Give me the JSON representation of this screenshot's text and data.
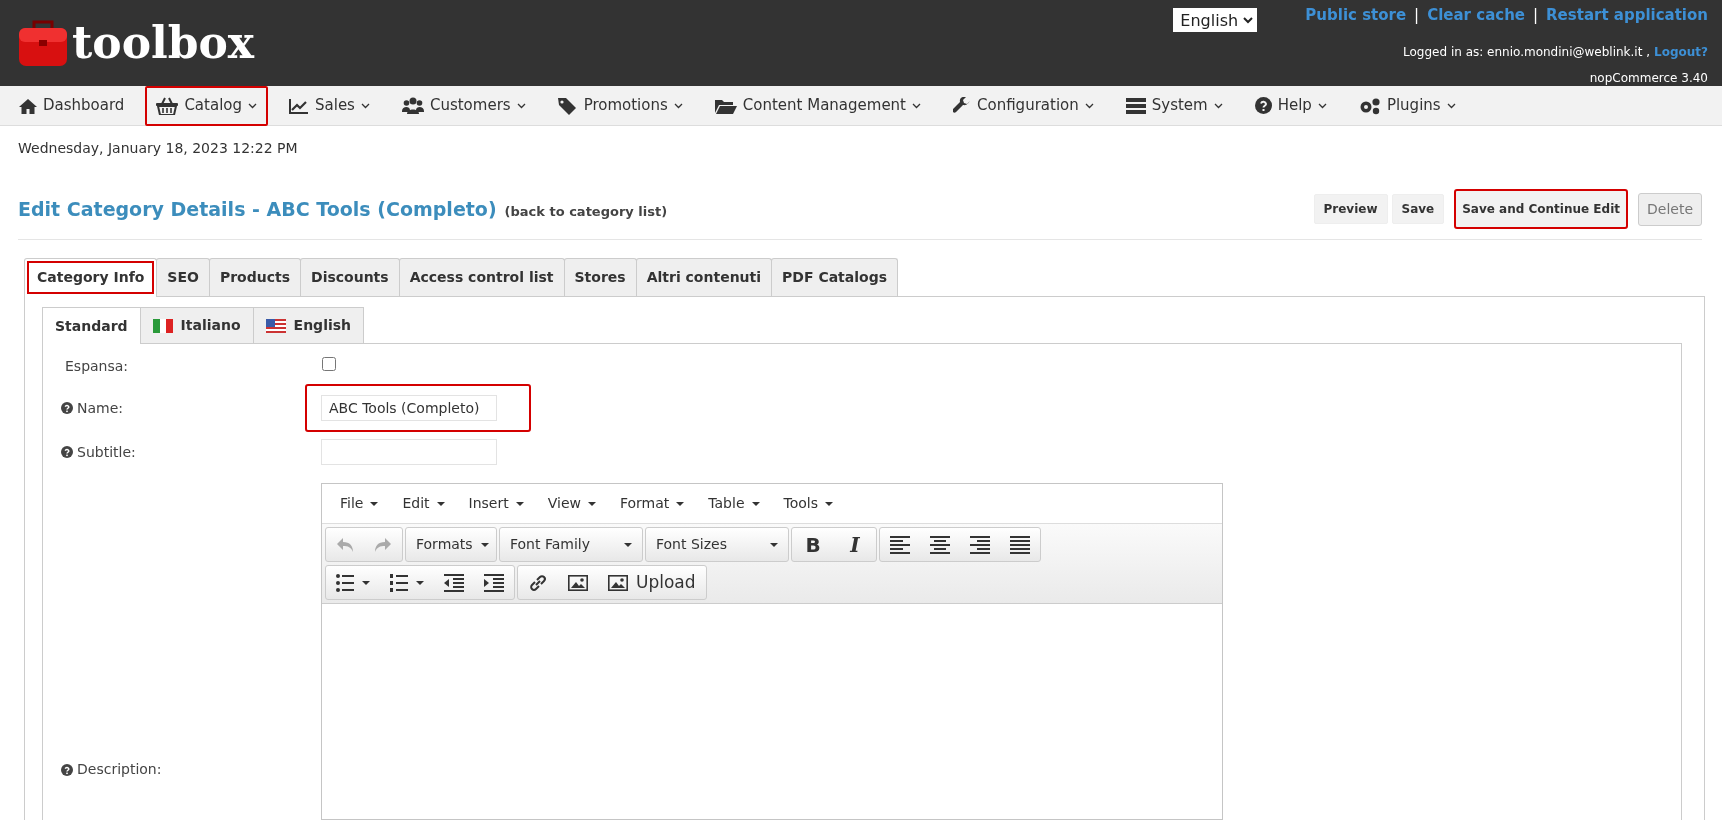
{
  "header": {
    "logo_text": "toolbox",
    "language": "English",
    "links": [
      "Public store",
      "Clear cache",
      "Restart application"
    ],
    "link_separator": "|",
    "logged_in": "Logged in as: ennio.mondini@weblink.it ,",
    "logout": "Logout?",
    "version": "nopCommerce 3.40"
  },
  "menu": [
    {
      "label": "Dashboard",
      "dropdown": false,
      "highlighted": false
    },
    {
      "label": "Catalog",
      "dropdown": true,
      "highlighted": true
    },
    {
      "label": "Sales",
      "dropdown": true,
      "highlighted": false
    },
    {
      "label": "Customers",
      "dropdown": true,
      "highlighted": false
    },
    {
      "label": "Promotions",
      "dropdown": true,
      "highlighted": false
    },
    {
      "label": "Content Management",
      "dropdown": true,
      "highlighted": false
    },
    {
      "label": "Configuration",
      "dropdown": true,
      "highlighted": false
    },
    {
      "label": "System",
      "dropdown": true,
      "highlighted": false
    },
    {
      "label": "Help",
      "dropdown": true,
      "highlighted": false
    },
    {
      "label": "Plugins",
      "dropdown": true,
      "highlighted": false
    }
  ],
  "date": "Wednesday, January 18, 2023 12:22 PM",
  "page": {
    "title": "Edit Category Details - ABC Tools (Completo)",
    "back_link": "(back to category list)",
    "buttons": [
      {
        "label": "Preview",
        "kind": "action",
        "highlighted": false
      },
      {
        "label": "Save",
        "kind": "action",
        "highlighted": false
      },
      {
        "label": "Save and Continue Edit",
        "kind": "action",
        "highlighted": true
      },
      {
        "label": "Delete",
        "kind": "delete",
        "highlighted": false
      }
    ]
  },
  "tabs": [
    {
      "label": "Category Info",
      "selected": true,
      "highlighted": true
    },
    {
      "label": "SEO",
      "selected": false,
      "highlighted": false
    },
    {
      "label": "Products",
      "selected": false,
      "highlighted": false
    },
    {
      "label": "Discounts",
      "selected": false,
      "highlighted": false
    },
    {
      "label": "Access control list",
      "selected": false,
      "highlighted": false
    },
    {
      "label": "Stores",
      "selected": false,
      "highlighted": false
    },
    {
      "label": "Altri contenuti",
      "selected": false,
      "highlighted": false
    },
    {
      "label": "PDF Catalogs",
      "selected": false,
      "highlighted": false
    }
  ],
  "language_tabs": [
    {
      "label": "Standard",
      "selected": true
    },
    {
      "label": "Italiano",
      "selected": false
    },
    {
      "label": "English",
      "selected": false
    }
  ],
  "fields": [
    {
      "kind": "checkbox",
      "label": "Espansa:",
      "help": false,
      "checked": false
    },
    {
      "kind": "text",
      "label": "Name:",
      "help": true,
      "value": "ABC Tools (Completo)",
      "highlighted": true
    },
    {
      "kind": "text",
      "label": "Subtitle:",
      "help": true,
      "highlighted": false
    },
    {
      "kind": "editor",
      "label": "Description:",
      "help": true
    }
  ],
  "editor": {
    "menu": [
      "File",
      "Edit",
      "Insert",
      "View",
      "Format",
      "Table",
      "Tools"
    ],
    "history": [
      {
        "disabled": true
      },
      {
        "disabled": true
      }
    ],
    "formats": "Formats",
    "font_family": "Font Family",
    "font_sizes": "Font Sizes",
    "bold": "B",
    "italic": "I",
    "upload": "Upload"
  }
}
